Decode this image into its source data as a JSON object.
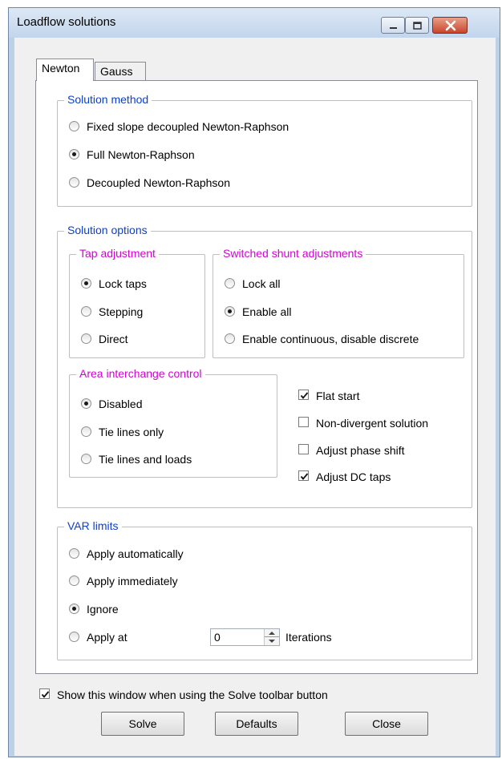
{
  "window": {
    "title": "Loadflow solutions"
  },
  "tabs": [
    {
      "label": "Newton",
      "active": true
    },
    {
      "label": "Gauss",
      "active": false
    }
  ],
  "solution_method": {
    "title": "Solution method",
    "options": [
      {
        "label": "Fixed slope decoupled Newton-Raphson",
        "checked": false
      },
      {
        "label": "Full Newton-Raphson",
        "checked": true
      },
      {
        "label": "Decoupled Newton-Raphson",
        "checked": false
      }
    ]
  },
  "solution_options": {
    "title": "Solution options",
    "tap_adjustment": {
      "title": "Tap adjustment",
      "options": [
        {
          "label": "Lock taps",
          "checked": true
        },
        {
          "label": "Stepping",
          "checked": false
        },
        {
          "label": "Direct",
          "checked": false
        }
      ]
    },
    "switched_shunt": {
      "title": "Switched shunt adjustments",
      "options": [
        {
          "label": "Lock all",
          "checked": false
        },
        {
          "label": "Enable all",
          "checked": true
        },
        {
          "label": "Enable continuous, disable discrete",
          "checked": false
        }
      ]
    },
    "area_interchange": {
      "title": "Area interchange control",
      "options": [
        {
          "label": "Disabled",
          "checked": true
        },
        {
          "label": "Tie lines only",
          "checked": false
        },
        {
          "label": "Tie lines and loads",
          "checked": false
        }
      ]
    },
    "checkboxes": [
      {
        "label": "Flat start",
        "checked": true
      },
      {
        "label": "Non-divergent solution",
        "checked": false
      },
      {
        "label": "Adjust phase shift",
        "checked": false
      },
      {
        "label": "Adjust DC taps",
        "checked": true
      }
    ]
  },
  "var_limits": {
    "title": "VAR limits",
    "options": [
      {
        "label": "Apply automatically",
        "checked": false
      },
      {
        "label": "Apply immediately",
        "checked": false
      },
      {
        "label": "Ignore",
        "checked": true
      },
      {
        "label": "Apply at",
        "checked": false
      }
    ],
    "iterations_value": "0",
    "iterations_label": "Iterations"
  },
  "show_window": {
    "label": "Show this window when using the Solve toolbar button",
    "checked": true
  },
  "buttons": {
    "solve": "Solve",
    "defaults": "Defaults",
    "close": "Close"
  },
  "colors": {
    "group_title_blue": "#0b3fd1",
    "group_title_magenta": "#d400d4",
    "close_button": "#c9452c"
  }
}
